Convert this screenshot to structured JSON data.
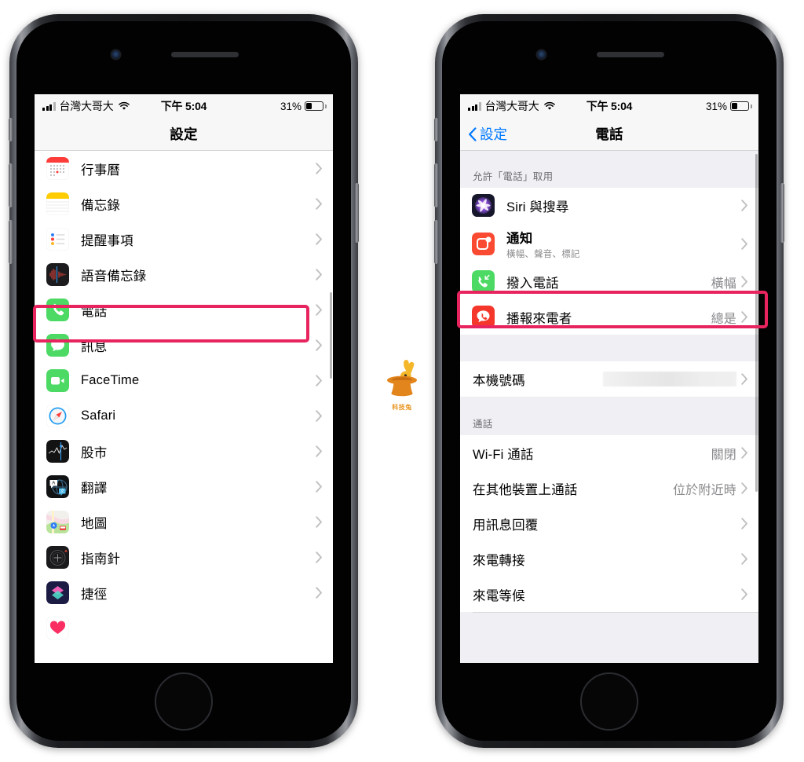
{
  "watermark": {
    "text": "科技兔",
    "icon": "rabbit-in-hat-logo",
    "color": "#E8941F"
  },
  "highlight_color": "#E8245F",
  "phones": {
    "left": {
      "statusbar": {
        "carrier": "台灣大哥大",
        "time": "下午 5:04",
        "battery_percent": "31%"
      },
      "navbar": {
        "title": "設定"
      },
      "rows": [
        {
          "label": "行事曆",
          "icon": "calendar-app-icon"
        },
        {
          "label": "備忘錄",
          "icon": "notes-app-icon"
        },
        {
          "label": "提醒事項",
          "icon": "reminders-app-icon"
        },
        {
          "label": "語音備忘錄",
          "icon": "voice-memos-app-icon"
        },
        {
          "label": "電話",
          "icon": "phone-app-icon",
          "highlighted": true
        },
        {
          "label": "訊息",
          "icon": "messages-app-icon"
        },
        {
          "label": "FaceTime",
          "icon": "facetime-app-icon"
        },
        {
          "label": "Safari",
          "icon": "safari-app-icon"
        },
        {
          "label": "股市",
          "icon": "stocks-app-icon"
        },
        {
          "label": "翻譯",
          "icon": "translate-app-icon"
        },
        {
          "label": "地圖",
          "icon": "maps-app-icon"
        },
        {
          "label": "指南針",
          "icon": "compass-app-icon"
        },
        {
          "label": "捷徑",
          "icon": "shortcuts-app-icon"
        },
        {
          "label": "",
          "icon": "health-app-icon"
        }
      ]
    },
    "right": {
      "statusbar": {
        "carrier": "台灣大哥大",
        "time": "下午 5:04",
        "battery_percent": "31%"
      },
      "navbar": {
        "back_label": "設定",
        "title": "電話"
      },
      "sections": [
        {
          "header": "允許「電話」取用",
          "rows": [
            {
              "label": "Siri 與搜尋",
              "icon": "siri-app-icon"
            },
            {
              "label": "通知",
              "sublabel": "橫幅、聲音、標記",
              "icon": "notifications-app-icon"
            },
            {
              "label": "撥入電話",
              "value": "橫幅",
              "icon": "incoming-calls-icon",
              "highlighted": true
            },
            {
              "label": "播報來電者",
              "value": "總是",
              "icon": "announce-calls-icon"
            }
          ]
        },
        {
          "header": "",
          "rows": [
            {
              "label": "本機號碼",
              "value_masked": true
            }
          ]
        },
        {
          "header": "通話",
          "rows": [
            {
              "label": "Wi-Fi 通話",
              "value": "關閉"
            },
            {
              "label": "在其他裝置上通話",
              "value": "位於附近時"
            },
            {
              "label": "用訊息回覆",
              "value": ""
            },
            {
              "label": "來電轉接",
              "value": ""
            },
            {
              "label": "來電等候",
              "value": ""
            }
          ]
        }
      ]
    }
  }
}
